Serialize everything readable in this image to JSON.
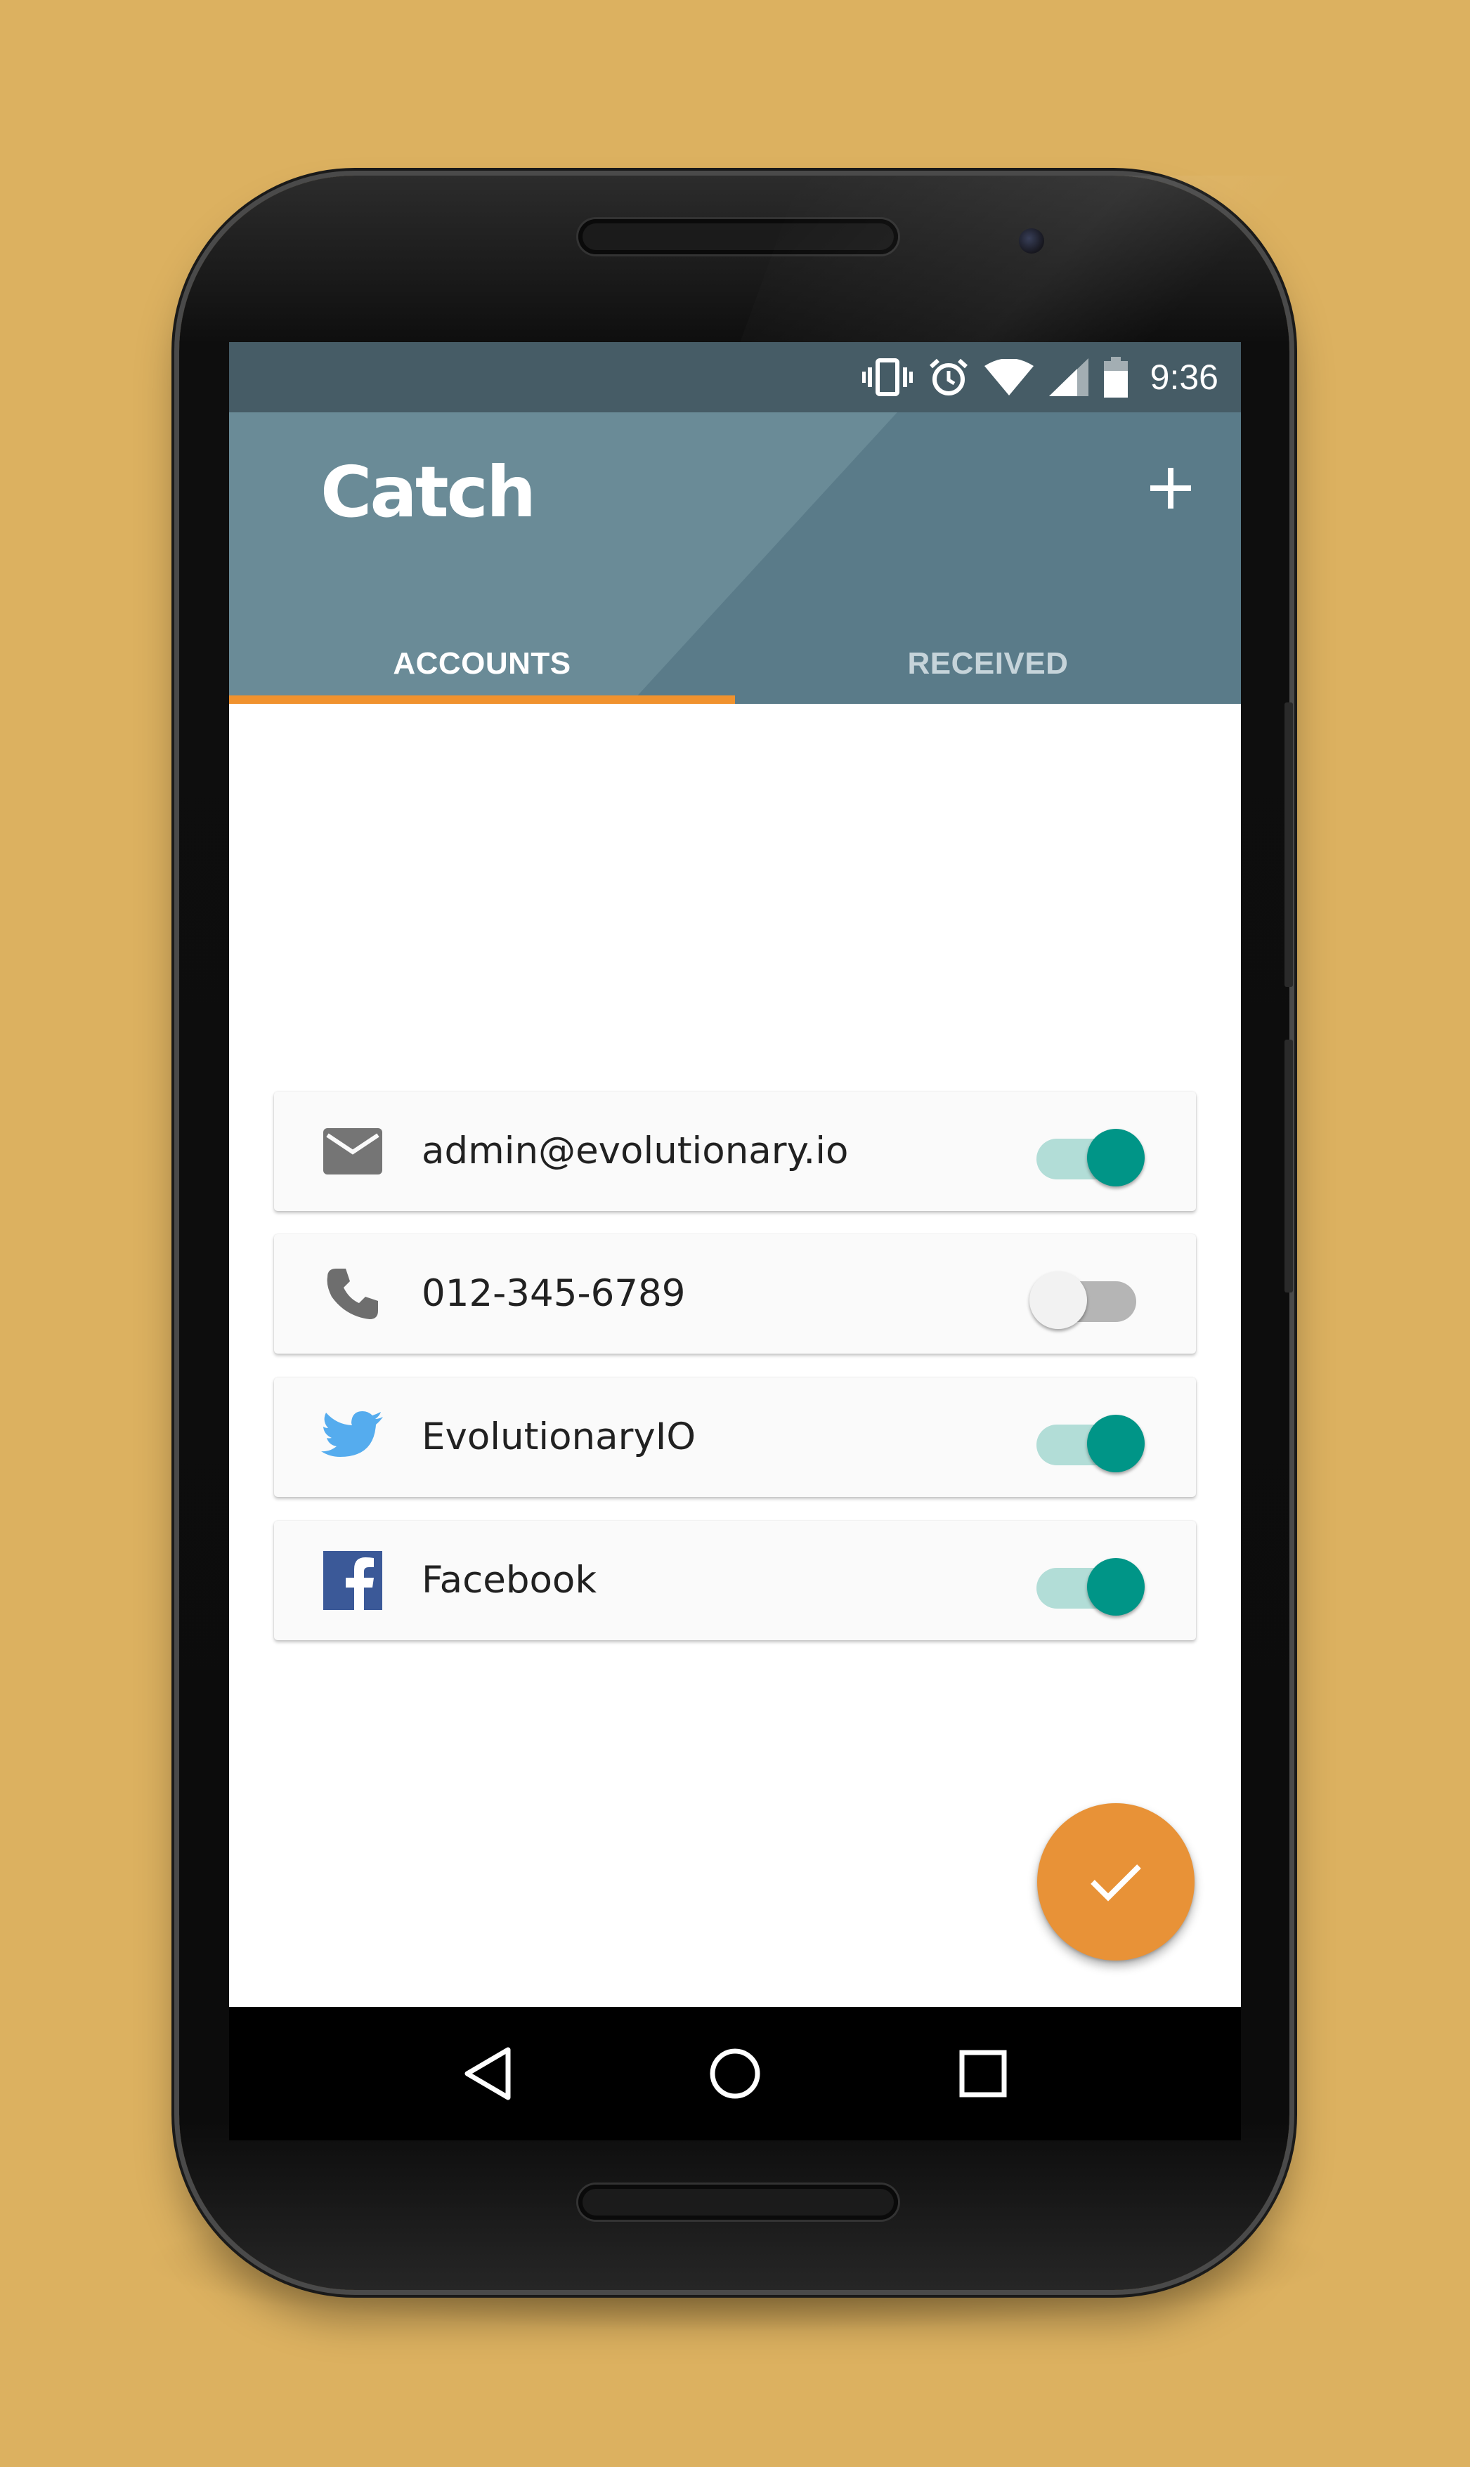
{
  "status_bar": {
    "time": "9:36",
    "icons": [
      "vibrate-icon",
      "alarm-icon",
      "wifi-icon",
      "signal-icon",
      "battery-icon"
    ]
  },
  "app_bar": {
    "title": "Catch",
    "add_icon": "plus-icon"
  },
  "tabs": [
    {
      "label": "ACCOUNTS",
      "active": true
    },
    {
      "label": "RECEIVED",
      "active": false
    }
  ],
  "accounts": [
    {
      "icon": "email-icon",
      "label": "admin@evolutionary.io",
      "enabled": true
    },
    {
      "icon": "phone-icon",
      "label": "012-345-6789",
      "enabled": false
    },
    {
      "icon": "twitter-icon",
      "label": "EvolutionaryIO",
      "enabled": true
    },
    {
      "icon": "facebook-icon",
      "label": "Facebook",
      "enabled": true
    }
  ],
  "fab": {
    "icon": "check-icon"
  },
  "nav_bar": {
    "buttons": [
      "back-icon",
      "home-icon",
      "recents-icon"
    ]
  },
  "colors": {
    "background": "#dcb160",
    "status_bar": "#465c66",
    "app_bar": "#5a7b89",
    "tab_indicator": "#f0922e",
    "switch_on": "#009587",
    "fab": "#e89237",
    "twitter": "#55acee",
    "facebook": "#3b5998"
  }
}
